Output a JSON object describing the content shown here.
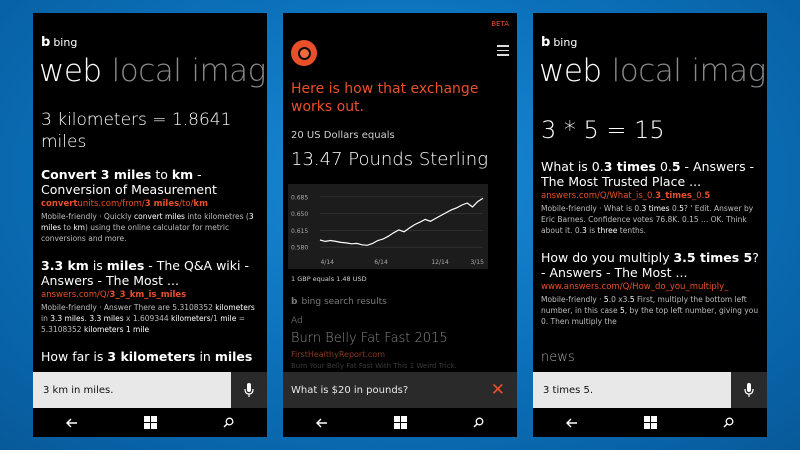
{
  "phone1": {
    "brand": "bing",
    "pivots": [
      "web",
      "local",
      "image"
    ],
    "answer": "3 kilometers = 1.8641 miles",
    "results": [
      {
        "title_html": "<b>Convert 3 miles</b> to <b>km</b> - Conversion of Measurement",
        "url_html": "<b>convert</b>units.com/from/<b>3 miles</b>/to/<b>km</b>",
        "snippet_html": "Mobile-friendly · Quickly <b>convert miles</b> into kilometres (<b>3 miles</b> to <b>km</b>) using the online calculator for metric conversions and more."
      },
      {
        "title_html": "<b>3.3 km</b> is <b>miles</b> - The Q&amp;A wiki - Answers - The Most ...",
        "url_html": "answers.com/Q/<b>3_3_km_is_miles</b>",
        "snippet_html": "Mobile-friendly · Answer There are 5.3108352 <b>kilometers</b> in <b>3.3 miles</b>. <b>3.3 miles</b> x 1.609344 <b>kilometers</b>/1 <b>mile</b> = 5.3108352 <b>kilometers 1 mile</b>"
      },
      {
        "title_html": "How far is <b>3 kilometers</b> in <b>miles</b>",
        "url_html": "",
        "snippet_html": ""
      }
    ],
    "search_value": "3 km in miles."
  },
  "phone2": {
    "beta": "BETA",
    "message": "Here is how that exchange works out.",
    "subline": "20 US Dollars equals",
    "main": "13.47 Pounds Sterling",
    "note": "1 GBP equals 1.48 USD",
    "bing_results": "bing search results",
    "ad_label": "Ad",
    "ad_title": "Burn Belly Fat Fast 2015",
    "ad_url": "FirstHealthyReport.com",
    "ad_fade": "Burn Your Belly Fat Fast With This 1 Weird Trick.",
    "query": "What is $20 in pounds?"
  },
  "phone3": {
    "brand": "bing",
    "pivots": [
      "web",
      "local",
      "image"
    ],
    "answer": "3 * 5 = 15",
    "results": [
      {
        "title_html": "What is 0.<b>3 times</b> 0.<b>5</b> - Answers - The Most Trusted Place ...",
        "url_html": "answers.com/Q/What_is_0.<b>3_times</b>_0.<b>5</b>",
        "snippet_html": "Mobile-friendly · What is 0.<b>3 times</b> 0.<b>5</b>? ' Edit. Answer by Eric Barnes. Confidence votes 76.8K. 0.15 ... OK. Think about it. 0.<b>3</b> is <b>three</b> tenths."
      },
      {
        "title_html": "How do you multiply <b>3.5 times 5</b>? - Answers - The Most ...",
        "url_html": "www.answers.com/Q/How_do_you_multiply_",
        "snippet_html": "Mobile-friendly · <b>5</b>.0 x3.<b>5</b> First, multiply the bottom left number, in this case <b>5</b>, by the top left number, giving you 0. Then multiply the"
      }
    ],
    "news": "news",
    "search_value": "3 times 5."
  },
  "chart_data": {
    "type": "line",
    "x": [
      "4/14",
      "6/14",
      "12/14",
      "3/15"
    ],
    "ytick_labels": [
      "0.580",
      "0.615",
      "0.650",
      "0.685"
    ],
    "ylim": [
      0.57,
      0.695
    ],
    "series": [
      {
        "values": [
          0.595,
          0.592,
          0.594,
          0.592,
          0.59,
          0.589,
          0.587,
          0.588,
          0.585,
          0.584,
          0.588,
          0.594,
          0.597,
          0.603,
          0.61,
          0.616,
          0.612,
          0.62,
          0.627,
          0.632,
          0.638,
          0.634,
          0.64,
          0.646,
          0.652,
          0.658,
          0.662,
          0.668,
          0.672,
          0.664,
          0.675,
          0.682
        ]
      }
    ],
    "grid": true
  },
  "colors": {
    "accent": "#e9502a",
    "background": "#0b6fb8"
  }
}
